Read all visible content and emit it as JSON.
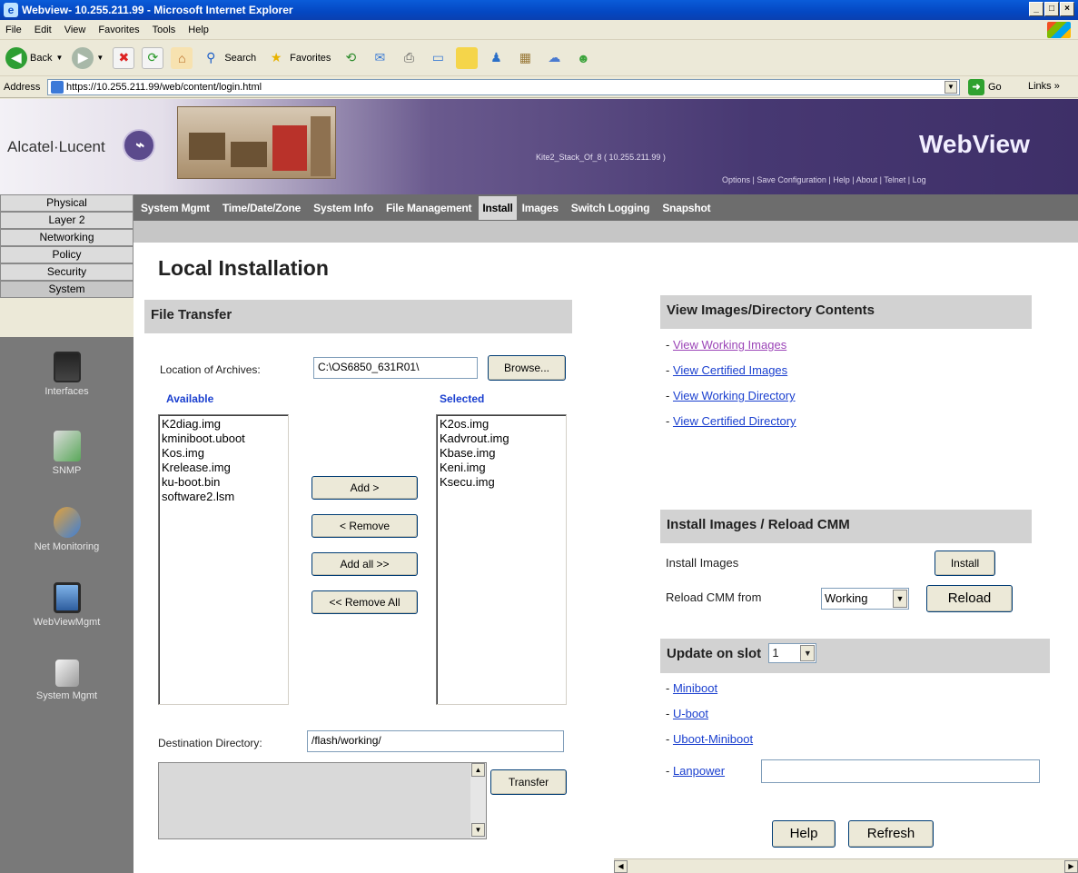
{
  "window": {
    "title": "Webview- 10.255.211.99 - Microsoft Internet Explorer",
    "controls": [
      "_",
      "□",
      "×"
    ]
  },
  "menu": [
    "File",
    "Edit",
    "View",
    "Favorites",
    "Tools",
    "Help"
  ],
  "toolbar": {
    "back": "Back",
    "search": "Search",
    "favorites": "Favorites"
  },
  "address": {
    "label": "Address",
    "url": "https://10.255.211.99/web/content/login.html",
    "go": "Go",
    "links": "Links »"
  },
  "header": {
    "brand": "Alcatel·Lucent",
    "host": "Kite2_Stack_Of_8  ( 10.255.211.99 )",
    "app_title": "WebView",
    "links": "Options  |  Save Configuration  | Help | About | Telnet | Log"
  },
  "left_tabs": [
    "Physical",
    "Layer 2",
    "Networking",
    "Policy",
    "Security",
    "System"
  ],
  "left_nav": [
    "Interfaces",
    "SNMP",
    "Net Monitoring",
    "WebViewMgmt",
    "System Mgmt"
  ],
  "top_tabs": [
    "System Mgmt",
    "Time/Date/Zone",
    "System Info",
    "File Management",
    "Install",
    "Images",
    "Switch Logging",
    "Snapshot"
  ],
  "page_title": "Local Installation",
  "file_transfer": {
    "heading": "File Transfer",
    "location_label": "Location of Archives:",
    "location_value": "C:\\OS6850_631R01\\",
    "browse": "Browse...",
    "available_label": "Available",
    "selected_label": "Selected",
    "available": [
      "K2diag.img",
      "kminiboot.uboot",
      "Kos.img",
      "Krelease.img",
      "ku-boot.bin",
      "software2.lsm"
    ],
    "selected": [
      "K2os.img",
      "Kadvrout.img",
      "Kbase.img",
      "Keni.img",
      "Ksecu.img"
    ],
    "add": "Add >",
    "remove": "< Remove",
    "add_all": "Add all >>",
    "remove_all": "<< Remove All",
    "dest_label": "Destination Directory:",
    "dest_value": "/flash/working/",
    "transfer": "Transfer"
  },
  "view_images": {
    "heading": "View Images/Directory Contents",
    "links": [
      "View Working Images",
      "View Certified Images",
      "View Working Directory",
      "View Certified Directory"
    ]
  },
  "install_reload": {
    "heading": "Install Images / Reload CMM",
    "install_label": "Install Images",
    "install_btn": "Install",
    "reload_label": "Reload CMM from",
    "reload_value": "Working",
    "reload_btn": "Reload"
  },
  "update_slot": {
    "heading": "Update on slot",
    "slot_value": "1",
    "links": [
      "Miniboot",
      "U-boot",
      "Uboot-Miniboot",
      "Lanpower"
    ],
    "lanpower_value": ""
  },
  "footer": {
    "help": "Help",
    "refresh": "Refresh"
  }
}
